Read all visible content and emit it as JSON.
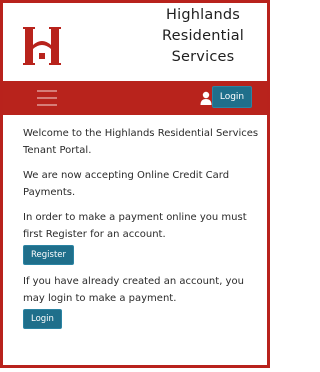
{
  "header": {
    "brand_lines": [
      "Highlands",
      "Residential",
      "Services"
    ],
    "logo_letter": "H"
  },
  "navbar": {
    "menu_icon": "hamburger-menu-icon",
    "user_icon": "user-icon",
    "login_label": "Login"
  },
  "main": {
    "welcome": "Welcome to the Highlands Residential Services Tenant Portal.",
    "accepting": "We are now accepting Online Credit Card Payments.",
    "register_prompt": "In order to make a payment online you must first Register for an account.",
    "register_label": "Register",
    "login_prompt": "If you have already created an account, you may login to make a payment.",
    "login_label": "Login"
  },
  "colors": {
    "brand_red": "#b8231c",
    "button_blue": "#1f6f8b"
  }
}
